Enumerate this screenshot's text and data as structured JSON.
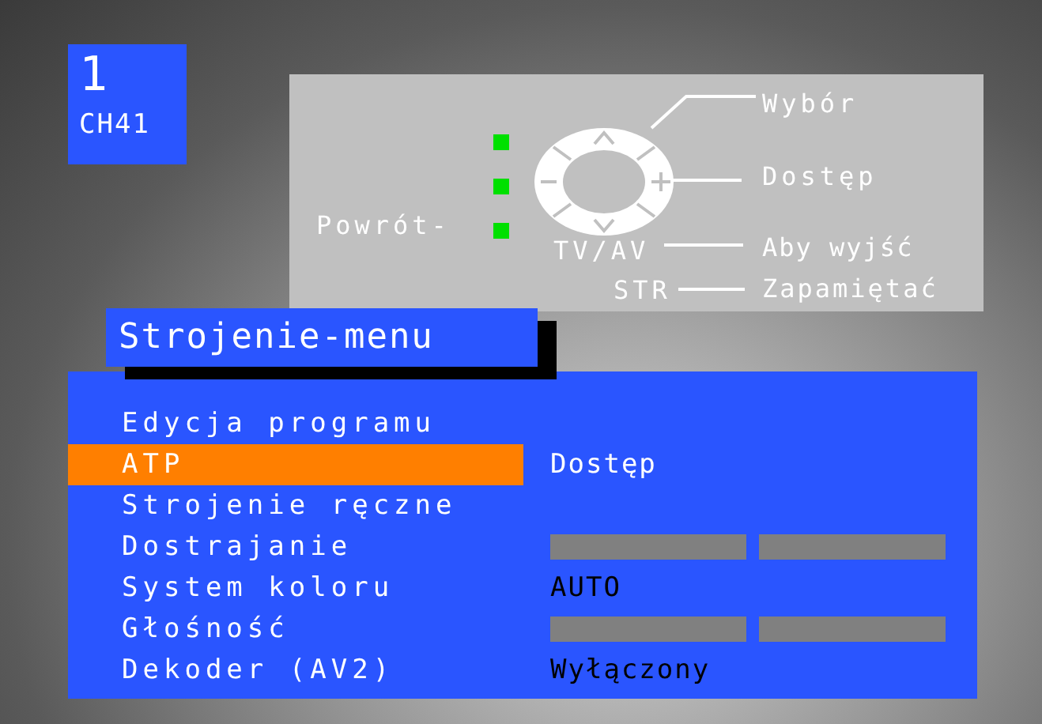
{
  "channel": {
    "number": "1",
    "name": "CH41"
  },
  "help": {
    "return_label": "Powrót-",
    "select_label": "Wybór",
    "access_label": "Dostęp",
    "exit_key": "TV/AV",
    "exit_label": "Aby wyjść",
    "store_key": "STR",
    "store_label": "Zapamiętać"
  },
  "menu": {
    "title": "Strojenie-menu",
    "items": [
      {
        "label": "Edycja programu",
        "selected": false,
        "kind": "none"
      },
      {
        "label": "ATP",
        "selected": true,
        "kind": "text",
        "value": "Dostęp"
      },
      {
        "label": "Strojenie ręczne",
        "selected": false,
        "kind": "none"
      },
      {
        "label": "Dostrajanie",
        "selected": false,
        "kind": "bars"
      },
      {
        "label": "System koloru",
        "selected": false,
        "kind": "text",
        "value": "AUTO"
      },
      {
        "label": "Głośność",
        "selected": false,
        "kind": "bars"
      },
      {
        "label": "Dekoder (AV2)",
        "selected": false,
        "kind": "text",
        "value": "Wyłączony"
      }
    ]
  }
}
